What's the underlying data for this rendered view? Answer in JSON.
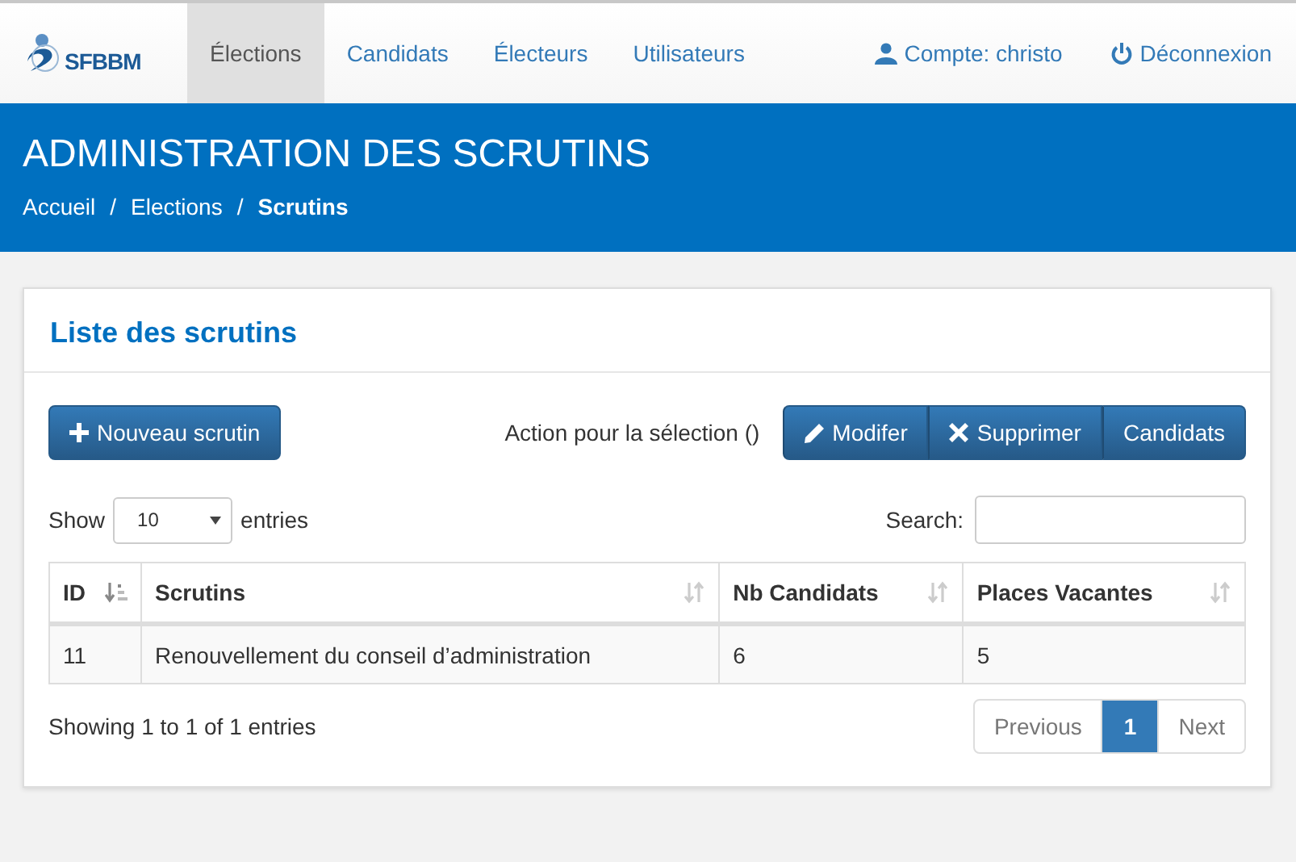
{
  "navbar": {
    "logo": "SFBBM",
    "items": [
      {
        "label": "Élections",
        "selected": true
      },
      {
        "label": "Candidats",
        "selected": false
      },
      {
        "label": "Électeurs",
        "selected": false
      },
      {
        "label": "Utilisateurs",
        "selected": false
      }
    ],
    "right_items": [
      {
        "kind": "account",
        "label": "Compte: christo"
      },
      {
        "kind": "logout",
        "label": "Déconnexion"
      }
    ]
  },
  "header": {
    "title": "ADMINISTRATION DES SCRUTINS",
    "breadcrumb_separator": "/",
    "breadcrumb": [
      {
        "label": "Accueil",
        "selected": false
      },
      {
        "label": "Elections",
        "selected": false
      },
      {
        "label": "Scrutins",
        "selected": true
      }
    ]
  },
  "panel": {
    "title": "Liste des scrutins",
    "new_button": "Nouveau scrutin",
    "selection_label": "Action pour la sélection ()",
    "actions": [
      {
        "kind": "edit",
        "label": "Modifer"
      },
      {
        "kind": "delete",
        "label": "Supprimer"
      },
      {
        "kind": "plain",
        "label": "Candidats"
      }
    ],
    "length": {
      "before": "Show",
      "value": "10",
      "after": "entries"
    },
    "search": {
      "label": "Search:"
    },
    "table": {
      "columns": [
        {
          "label": "ID",
          "sorted": true
        },
        {
          "label": "Scrutins",
          "sorted": false
        },
        {
          "label": "Nb Candidats",
          "sorted": false
        },
        {
          "label": "Places Vacantes",
          "sorted": false
        }
      ],
      "rows": [
        [
          "11",
          "Renouvellement du conseil d’administration",
          "6",
          "5"
        ]
      ]
    },
    "info": "Showing 1 to 1 of 1 entries",
    "pagination": [
      {
        "label": "Previous",
        "disabled": true,
        "selected": false
      },
      {
        "label": "1",
        "disabled": false,
        "selected": true
      },
      {
        "label": "Next",
        "disabled": true,
        "selected": false
      }
    ]
  }
}
